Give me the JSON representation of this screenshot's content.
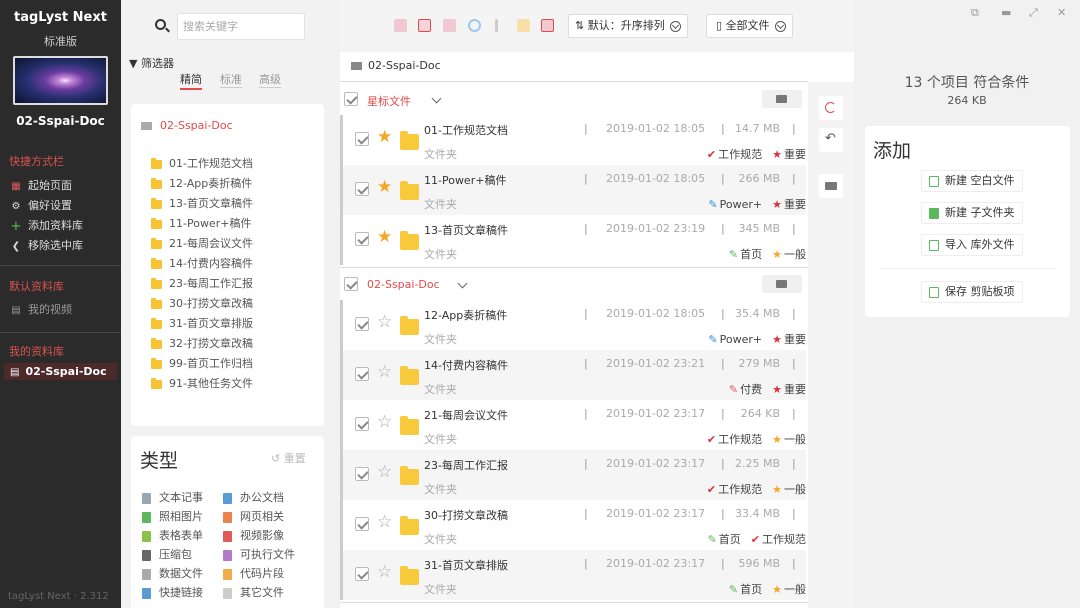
{
  "app": {
    "title": "tagLyst Next",
    "edition": "标准版",
    "library": "02-Sspai-Doc",
    "version": "tagLyst Next · 2.312"
  },
  "sidebar": {
    "shortcuts_title": "快捷方式栏",
    "shortcuts": [
      "起始页面",
      "偏好设置",
      "添加资料库",
      "移除选中库"
    ],
    "default_title": "默认资料库",
    "default_items": [
      "我的视频"
    ],
    "mine_title": "我的资料库",
    "mine_items": [
      "02-Sspai-Doc"
    ]
  },
  "filter": {
    "search_placeholder": "搜索关键字",
    "title": "筛选器",
    "tabs": [
      "精简",
      "标准",
      "高级"
    ],
    "tree_root": "02-Sspai-Doc",
    "tree": [
      "01-工作规范文档",
      "12-App奏折稿件",
      "13-首页文章稿件",
      "11-Power+稿件",
      "21-每周会议文件",
      "14-付费内容稿件",
      "23-每周工作汇报",
      "30-打捞文章改稿",
      "31-首页文章排版",
      "32-打捞文章改稿",
      "99-首页工作归档",
      "91-其他任务文件"
    ],
    "type_title": "类型",
    "type_reset": "重置",
    "types": [
      {
        "label": "文本记事",
        "color": "#9aa7b0"
      },
      {
        "label": "办公文档",
        "color": "#5b9bd5"
      },
      {
        "label": "照相图片",
        "color": "#5cb85c"
      },
      {
        "label": "网页相关",
        "color": "#e8834a"
      },
      {
        "label": "表格表单",
        "color": "#8bc34a"
      },
      {
        "label": "视频影像",
        "color": "#e05a5a"
      },
      {
        "label": "压缩包",
        "color": "#666666"
      },
      {
        "label": "可执行文件",
        "color": "#b07cc6"
      },
      {
        "label": "数据文件",
        "color": "#aaaaaa"
      },
      {
        "label": "代码片段",
        "color": "#f0ad4e"
      },
      {
        "label": "快捷链接",
        "color": "#5b9bd5"
      },
      {
        "label": "其它文件",
        "color": "#cccccc"
      }
    ]
  },
  "toolbar": {
    "sort": "默认：升序排列",
    "scope": "全部文件"
  },
  "main": {
    "breadcrumb": "02-Sspai-Doc",
    "groups": [
      {
        "title": "星标文件",
        "rows": [
          {
            "name": "01-工作规范文档",
            "kind": "文件夹",
            "date": "2019-01-02 18:05",
            "size": "14.7 MB",
            "starred": true,
            "tags": [
              {
                "icon": "✔",
                "color": "#d9323a",
                "label": "工作规范"
              },
              {
                "icon": "★",
                "color": "#d9323a",
                "label": "重要"
              }
            ]
          },
          {
            "name": "11-Power+稿件",
            "kind": "文件夹",
            "date": "2019-01-02 18:05",
            "size": "266 MB",
            "starred": true,
            "tags": [
              {
                "icon": "✎",
                "color": "#2f8fe0",
                "label": "Power+"
              },
              {
                "icon": "★",
                "color": "#d9323a",
                "label": "重要"
              }
            ]
          },
          {
            "name": "13-首页文章稿件",
            "kind": "文件夹",
            "date": "2019-01-02 23:19",
            "size": "345 MB",
            "starred": true,
            "tags": [
              {
                "icon": "✎",
                "color": "#5cb85c",
                "label": "首页"
              },
              {
                "icon": "★",
                "color": "#f5a623",
                "label": "一般"
              }
            ]
          }
        ]
      },
      {
        "title": "02-Sspai-Doc",
        "rows": [
          {
            "name": "12-App奏折稿件",
            "kind": "文件夹",
            "date": "2019-01-02 18:05",
            "size": "35.4 MB",
            "starred": false,
            "tags": [
              {
                "icon": "✎",
                "color": "#2f8fe0",
                "label": "Power+"
              },
              {
                "icon": "★",
                "color": "#d9323a",
                "label": "重要"
              }
            ]
          },
          {
            "name": "14-付费内容稿件",
            "kind": "文件夹",
            "date": "2019-01-02 23:21",
            "size": "279 MB",
            "starred": false,
            "tags": [
              {
                "icon": "✎",
                "color": "#e05a5a",
                "label": "付费"
              },
              {
                "icon": "★",
                "color": "#d9323a",
                "label": "重要"
              }
            ]
          },
          {
            "name": "21-每周会议文件",
            "kind": "文件夹",
            "date": "2019-01-02 23:17",
            "size": "264 KB",
            "starred": false,
            "tags": [
              {
                "icon": "✔",
                "color": "#d9323a",
                "label": "工作规范"
              },
              {
                "icon": "★",
                "color": "#f5a623",
                "label": "一般"
              }
            ]
          },
          {
            "name": "23-每周工作汇报",
            "kind": "文件夹",
            "date": "2019-01-02 23:17",
            "size": "2.25 MB",
            "starred": false,
            "tags": [
              {
                "icon": "✔",
                "color": "#d9323a",
                "label": "工作规范"
              },
              {
                "icon": "★",
                "color": "#f5a623",
                "label": "一般"
              }
            ]
          },
          {
            "name": "30-打捞文章改稿",
            "kind": "文件夹",
            "date": "2019-01-02 23:17",
            "size": "33.4 MB",
            "starred": false,
            "tags": [
              {
                "icon": "✎",
                "color": "#5cb85c",
                "label": "首页"
              },
              {
                "icon": "✔",
                "color": "#d9323a",
                "label": "工作规范"
              }
            ]
          },
          {
            "name": "31-首页文章排版",
            "kind": "文件夹",
            "date": "2019-01-02 23:17",
            "size": "596 MB",
            "starred": false,
            "tags": [
              {
                "icon": "✎",
                "color": "#5cb85c",
                "label": "首页"
              },
              {
                "icon": "★",
                "color": "#f5a623",
                "label": "一般"
              }
            ]
          }
        ]
      }
    ]
  },
  "right": {
    "count": "13 个项目 符合条件",
    "size": "264 KB",
    "add_title": "添加",
    "add_buttons": [
      "新建 空白文件",
      "新建 子文件夹",
      "导入 库外文件",
      "保存 剪贴板项"
    ]
  }
}
